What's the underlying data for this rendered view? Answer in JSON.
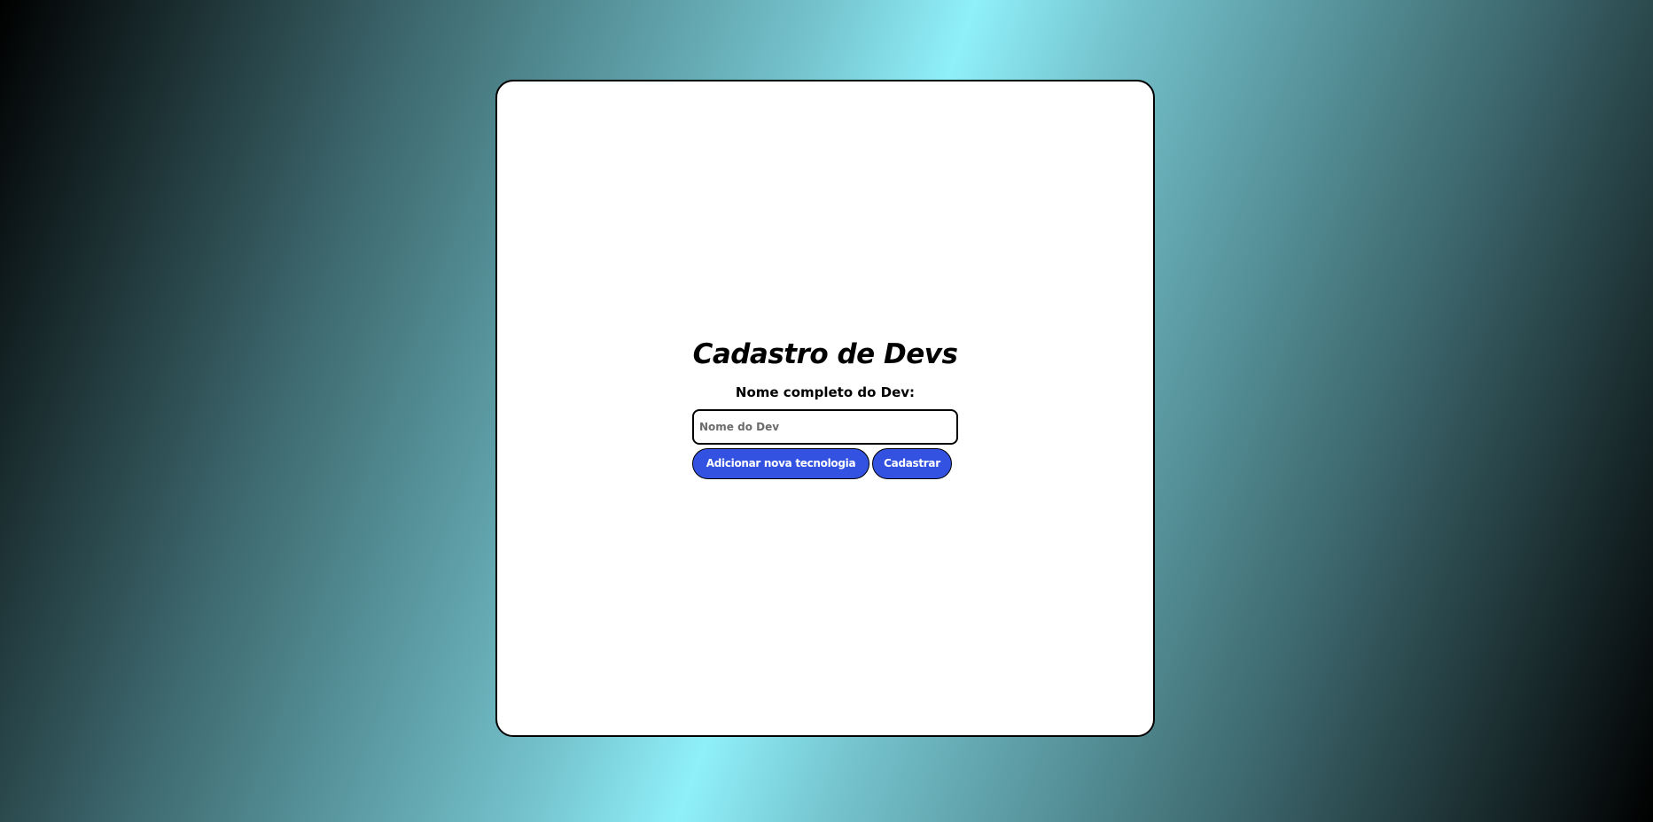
{
  "form": {
    "title": "Cadastro de Devs",
    "name_label": "Nome completo do Dev:",
    "name_input": {
      "value": "",
      "placeholder": "Nome do Dev"
    },
    "add_tech_button": "Adicionar nova tecnologia",
    "submit_button": "Cadastrar"
  },
  "colors": {
    "accent": "#3452e1",
    "card_background": "#ffffff",
    "gradient_light": "#8ff0fa",
    "gradient_dark": "#000000"
  }
}
